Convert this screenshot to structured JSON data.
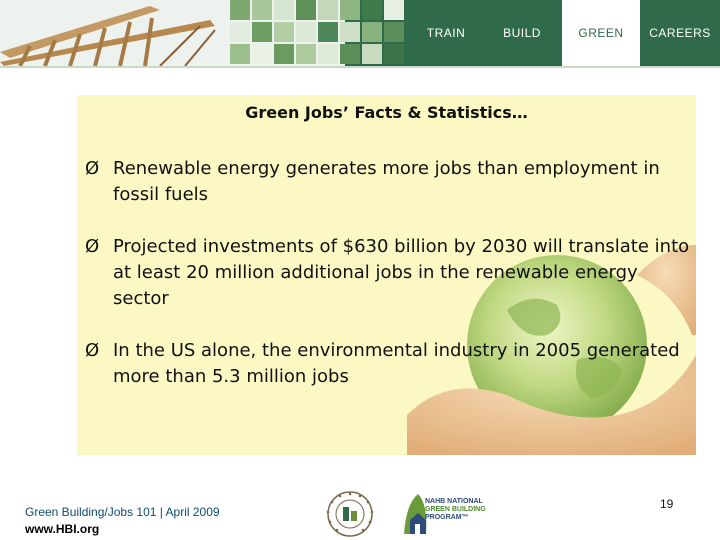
{
  "header": {
    "nav": [
      "TRAIN",
      "BUILD",
      "GREEN",
      "CAREERS"
    ],
    "active_tab": "GREEN"
  },
  "content": {
    "title": "Green Jobs’ Facts & Statistics…",
    "bullet_marker": "Ø",
    "bullets": [
      "Renewable energy generates more jobs than employment in fossil fuels",
      "Projected investments of $630 billion by 2030 will translate into at least 20 million additional jobs in the renewable energy sector",
      "In the US alone, the environmental industry in 2005 generated more than 5.3 million jobs"
    ]
  },
  "footer": {
    "course": "Green Building/Jobs 101 |  April 2009",
    "url": "www.HBI.org",
    "page_number": "19",
    "nahb_logo_text": [
      "NAHB NATIONAL",
      "GREEN BUILDING",
      "PROGRAM™"
    ]
  },
  "colors": {
    "header_green": "#2f6b4a",
    "panel_yellow": "#fbf8c4",
    "footer_blue": "#0f4d6b"
  },
  "icons": [
    "house-framing-photo",
    "hands-holding-globe-image",
    "hbi-logo",
    "nahb-green-building-logo"
  ]
}
